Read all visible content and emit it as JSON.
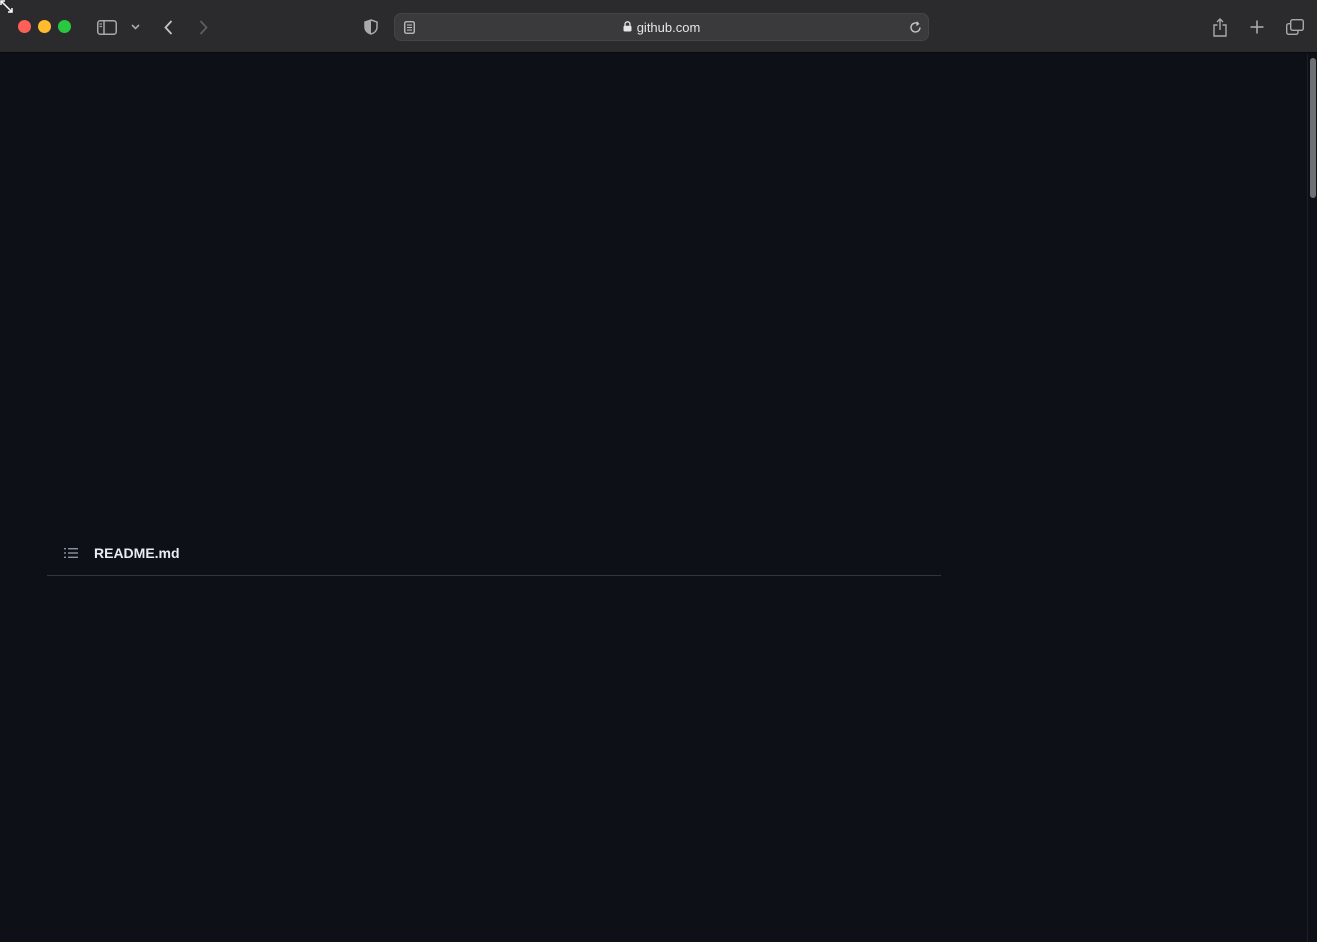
{
  "browser": {
    "url_host": "github.com",
    "icons": {
      "sidebar": "sidebar-icon",
      "tab_menu": "chevron-down-icon",
      "back": "chevron-left-icon",
      "forward": "chevron-right-icon",
      "privacy": "shield-icon",
      "reader": "reader-icon",
      "lock": "lock-icon",
      "reload": "reload-icon",
      "share": "share-icon",
      "new_tab": "plus-icon",
      "tabs_overview": "tabs-icon"
    },
    "colors": {
      "close": "#fe5f57",
      "minimize": "#febc2e",
      "maximize": "#28c840",
      "toolbar": "#2b2b2d",
      "page_bg": "#0d1117"
    }
  },
  "readme": {
    "filename": "README.md",
    "icon": "list-icon"
  }
}
